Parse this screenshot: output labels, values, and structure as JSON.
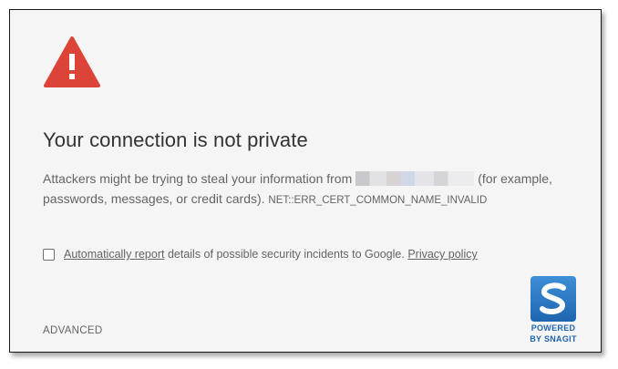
{
  "page": {
    "title": "Your connection is not private",
    "message_before": "Attackers might be trying to steal your information from",
    "message_after": "(for example, passwords, messages, or credit cards).",
    "error_code": "NET::ERR_CERT_COMMON_NAME_INVALID",
    "report": {
      "link_label": "Automatically report",
      "text": "details of possible security incidents to Google.",
      "privacy_label": "Privacy policy",
      "checked": false
    },
    "advanced_label": "ADVANCED"
  },
  "watermark": {
    "line1": "POWERED",
    "line2": "BY SNAGIT"
  },
  "colors": {
    "warning_red": "#db4437",
    "background": "#f5f5f5",
    "text": "#646464",
    "snagit_blue": "#1f65b0"
  },
  "icons": {
    "warning": "warning-triangle-icon",
    "watermark": "snagit-logo-icon"
  }
}
